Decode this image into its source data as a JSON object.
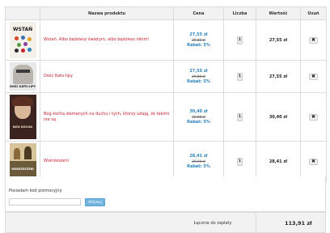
{
  "table": {
    "headers": [
      "Nazwa produktu",
      "Cena",
      "Liczba",
      "Wartość",
      "Usuń"
    ]
  },
  "items": [
    {
      "name": "Wstań. Albo będziesz świętym, albo będziesz nikim!",
      "price": "27,55 zł",
      "old_price": "29,00 zł",
      "discount": "Rabat: 5%",
      "qty": "1",
      "value": "27,55 zł",
      "cover_title": "WSTAŃ",
      "delete": "✖"
    },
    {
      "name": "Dość Kato-lipy",
      "price": "27,55 zł",
      "old_price": "29,00 zł",
      "discount": "Rabat: 5%",
      "qty": "1",
      "value": "27,55 zł",
      "cover_title": "DOŚĆ KATO-LIPY",
      "delete": "✖"
    },
    {
      "name": "Bóg kocha złamanych na duchu i tych, którzy udają, że takimi nie są",
      "price": "30,40 zł",
      "old_price": "32,00 zł",
      "discount": "Rabat: 5%",
      "qty": "1",
      "value": "30,40 zł",
      "cover_title": "BÓG KOCHA",
      "delete": "✖"
    },
    {
      "name": "Wskrzeszeni",
      "price": "28,41 zł",
      "old_price": "29,90 zł",
      "discount": "Rabat: 5%",
      "qty": "1",
      "value": "28,41 zł",
      "cover_title": "WSKRZESZENI",
      "delete": "✖"
    }
  ],
  "promo": {
    "label": "Posiadam kod promocyjny",
    "input_value": "",
    "button": "Aktywuj"
  },
  "total": {
    "label": "Łącznie do zapłaty",
    "value": "113,91 zł"
  }
}
